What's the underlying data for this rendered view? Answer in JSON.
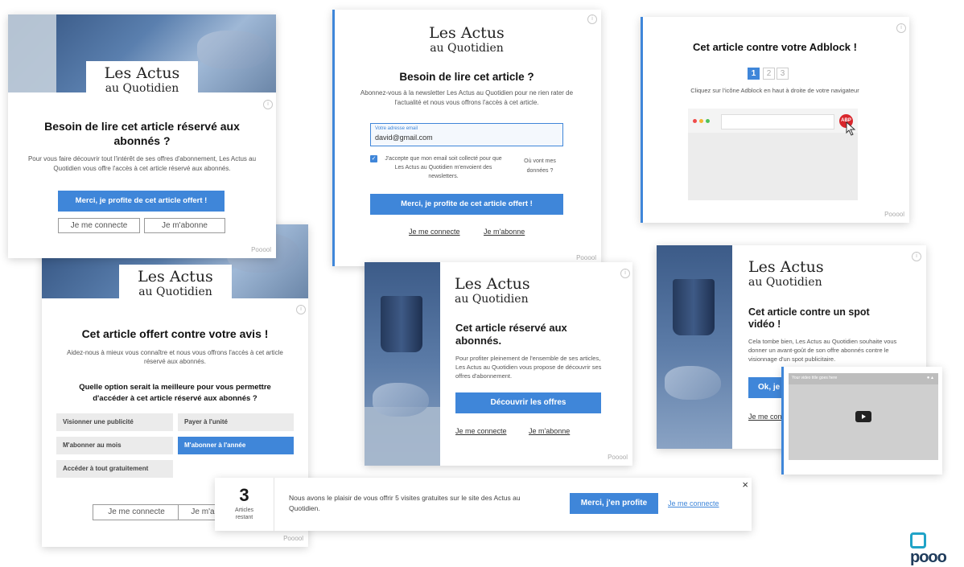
{
  "brand": {
    "logo_line1": "Les Actus",
    "logo_line2": "au Quotidien",
    "poool": "Pooool",
    "poool_logo": "pooo",
    "accent": "#3f86d9"
  },
  "card1": {
    "title": "Besoin de lire cet article réservé aux abonnés ?",
    "text": "Pour vous faire découvrir tout l'intérêt de ses offres d'abonnement, Les Actus au Quotidien vous offre l'accès à cet article réservé aux abonnés.",
    "primary": "Merci, je profite de cet article offert !",
    "login": "Je me connecte",
    "subscribe": "Je m'abonne"
  },
  "card2": {
    "title": "Besoin de lire cet article ?",
    "text": "Abonnez-vous à la newsletter Les Actus au Quotidien pour ne rien rater de l'actualité et nous vous offrons l'accès à cet article.",
    "email_label": "Votre adresse email",
    "email_value": "david@gmail.com",
    "consent": "J'accepte que mon email soit collecté pour que Les Actus au Quotidien m'envoient des newsletters.",
    "data_link": "Où vont mes données ?",
    "primary": "Merci, je profite de cet article offert !",
    "login": "Je me connecte",
    "subscribe": "Je m'abonne"
  },
  "card3": {
    "title": "Cet article contre votre Adblock !",
    "steps": [
      "1",
      "2",
      "3"
    ],
    "text": "Cliquez sur l'icône Adblock en haut à droite de votre navigateur",
    "abp": "ABP"
  },
  "card4": {
    "title": "Cet article offert contre votre avis !",
    "text": "Aidez-nous à mieux vous connaître et nous vous offrons l'accès à cet article réservé aux abonnés.",
    "question": "Quelle option serait la meilleure pour vous permettre d'accéder à cet article réservé aux abonnés ?",
    "options": [
      "Visionner une publicité",
      "Payer à l'unité",
      "M'abonner au mois",
      "M'abonner à l'année",
      "Accéder à tout gratuitement"
    ],
    "login": "Je me connecte",
    "subscribe": "Je m'a"
  },
  "card5": {
    "title": "Cet article réservé aux abonnés.",
    "text": "Pour profiter pleinement de l'ensemble de ses articles, Les Actus au Quotidien vous propose de découvrir ses offres d'abonnement.",
    "primary": "Découvrir les offres",
    "login": "Je me connecte",
    "subscribe": "Je m'abonne"
  },
  "card6": {
    "title": "Cet article contre un spot vidéo !",
    "text": "Cela tombe bien, Les Actus au Quotidien souhaite vous donner un avant-goût de son offre abonnés contre le visionnage d'un spot publicitaire.",
    "primary": "Ok, je v",
    "login": "Je me conn",
    "video_title": "Your video title goes here"
  },
  "banner": {
    "count": "3",
    "count_label": "Articles restant",
    "text": "Nous avons le plaisir de vous offrir 5 visites gratuites sur le site des Actus au Quotidien.",
    "primary": "Merci, j'en profite",
    "login": "Je me connecte",
    "close": "×"
  }
}
